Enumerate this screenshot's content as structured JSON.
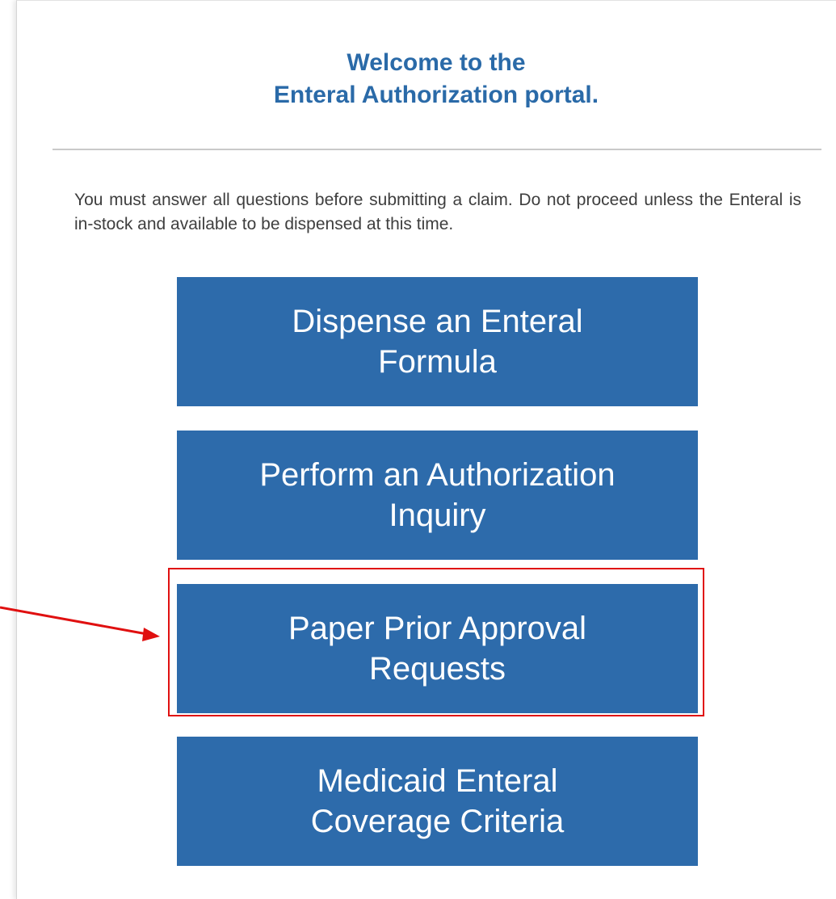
{
  "header": {
    "welcome_line1": "Welcome to the",
    "welcome_line2": "Enteral Authorization portal."
  },
  "instructions": {
    "text": "You must answer all questions before submitting a claim. Do not proceed unless the Enteral is in-stock and available to be dispensed at this time."
  },
  "buttons": [
    {
      "label": "Dispense an Enteral Formula"
    },
    {
      "label": "Perform an Authorization Inquiry"
    },
    {
      "label": "Paper Prior Approval Requests"
    },
    {
      "label": "Medicaid Enteral Coverage Criteria"
    }
  ],
  "annotation": {
    "highlight_color": "#e01010",
    "highlighted_button": "Paper Prior Approval Requests"
  },
  "colors": {
    "title": "#2a6aa8",
    "button_bg": "#2d6bab",
    "button_text": "#ffffff",
    "body_text": "#3e3e3e"
  }
}
